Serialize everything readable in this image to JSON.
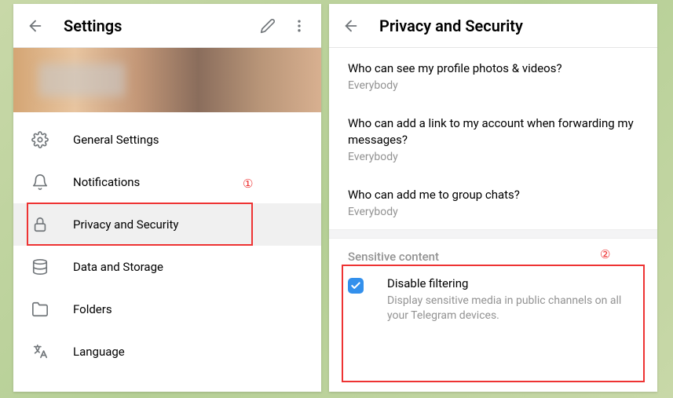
{
  "left": {
    "title": "Settings",
    "menu": [
      {
        "icon": "gear",
        "label": "General Settings"
      },
      {
        "icon": "bell",
        "label": "Notifications"
      },
      {
        "icon": "lock",
        "label": "Privacy and Security"
      },
      {
        "icon": "database",
        "label": "Data and Storage"
      },
      {
        "icon": "folder",
        "label": "Folders"
      },
      {
        "icon": "language",
        "label": "Language"
      }
    ]
  },
  "right": {
    "title": "Privacy and Security",
    "items": [
      {
        "title": "Who can see my profile photos & videos?",
        "value": "Everybody"
      },
      {
        "title": "Who can add a link to my account when forwarding my messages?",
        "value": "Everybody"
      },
      {
        "title": "Who can add me to group chats?",
        "value": "Everybody"
      }
    ],
    "sensitive": {
      "header": "Sensitive content",
      "checkbox_label": "Disable filtering",
      "checkbox_desc": "Display sensitive media in public channels on all your Telegram devices.",
      "checked": true
    }
  },
  "annotations": {
    "one": "①",
    "two": "②"
  }
}
